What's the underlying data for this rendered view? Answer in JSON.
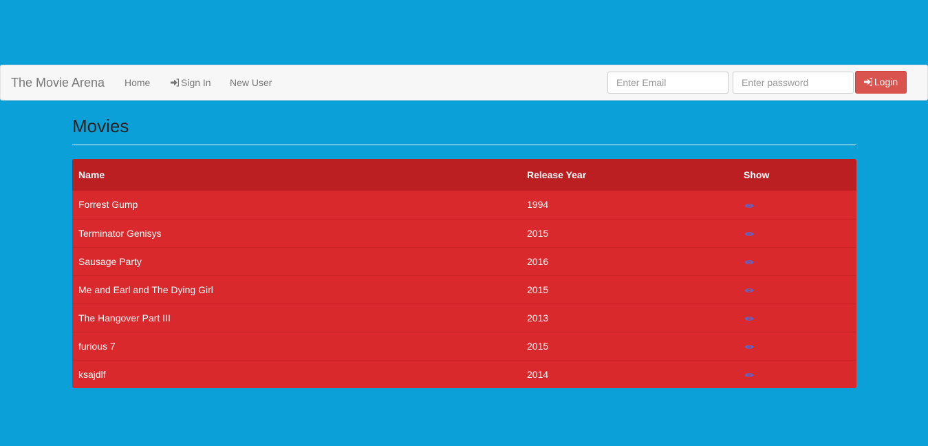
{
  "navbar": {
    "brand": "The Movie Arena",
    "links": [
      {
        "label": "Home",
        "icon": ""
      },
      {
        "label": "Sign In",
        "icon": "sign-in-icon"
      },
      {
        "label": "New User",
        "icon": ""
      }
    ],
    "email_placeholder": "Enter Email",
    "password_placeholder": "Enter password",
    "login_label": "Login",
    "login_icon": "sign-in-icon"
  },
  "page": {
    "title": "Movies"
  },
  "table": {
    "headers": [
      "Name",
      "Release Year",
      "Show"
    ],
    "rows": [
      {
        "name": "Forrest Gump",
        "year": "1994",
        "show_icon": "eye-icon"
      },
      {
        "name": "Terminator Genisys",
        "year": "2015",
        "show_icon": "eye-icon"
      },
      {
        "name": "Sausage Party",
        "year": "2016",
        "show_icon": "eye-icon"
      },
      {
        "name": "Me and Earl and The Dying Girl",
        "year": "2015",
        "show_icon": "eye-icon"
      },
      {
        "name": "The Hangover Part III",
        "year": "2013",
        "show_icon": "eye-icon"
      },
      {
        "name": "furious 7",
        "year": "2015",
        "show_icon": "eye-icon"
      },
      {
        "name": "ksajdlf",
        "year": "2014",
        "show_icon": "eye-icon"
      }
    ]
  },
  "colors": {
    "page_background": "#0ca0d8",
    "navbar_background": "#f7f7f7",
    "table_header": "#bc1f22",
    "table_row": "#da292c",
    "login_button": "#d9534f",
    "eye_icon": "#5b67c8"
  }
}
